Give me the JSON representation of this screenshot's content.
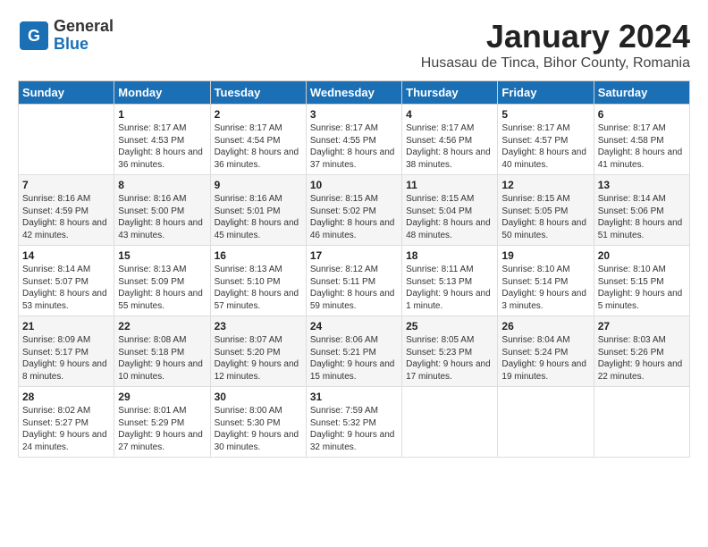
{
  "header": {
    "logo_general": "General",
    "logo_blue": "Blue",
    "month_title": "January 2024",
    "location": "Husasau de Tinca, Bihor County, Romania"
  },
  "weekdays": [
    "Sunday",
    "Monday",
    "Tuesday",
    "Wednesday",
    "Thursday",
    "Friday",
    "Saturday"
  ],
  "weeks": [
    [
      {
        "day": "",
        "sunrise": "",
        "sunset": "",
        "daylight": ""
      },
      {
        "day": "1",
        "sunrise": "Sunrise: 8:17 AM",
        "sunset": "Sunset: 4:53 PM",
        "daylight": "Daylight: 8 hours and 36 minutes."
      },
      {
        "day": "2",
        "sunrise": "Sunrise: 8:17 AM",
        "sunset": "Sunset: 4:54 PM",
        "daylight": "Daylight: 8 hours and 36 minutes."
      },
      {
        "day": "3",
        "sunrise": "Sunrise: 8:17 AM",
        "sunset": "Sunset: 4:55 PM",
        "daylight": "Daylight: 8 hours and 37 minutes."
      },
      {
        "day": "4",
        "sunrise": "Sunrise: 8:17 AM",
        "sunset": "Sunset: 4:56 PM",
        "daylight": "Daylight: 8 hours and 38 minutes."
      },
      {
        "day": "5",
        "sunrise": "Sunrise: 8:17 AM",
        "sunset": "Sunset: 4:57 PM",
        "daylight": "Daylight: 8 hours and 40 minutes."
      },
      {
        "day": "6",
        "sunrise": "Sunrise: 8:17 AM",
        "sunset": "Sunset: 4:58 PM",
        "daylight": "Daylight: 8 hours and 41 minutes."
      }
    ],
    [
      {
        "day": "7",
        "sunrise": "Sunrise: 8:16 AM",
        "sunset": "Sunset: 4:59 PM",
        "daylight": "Daylight: 8 hours and 42 minutes."
      },
      {
        "day": "8",
        "sunrise": "Sunrise: 8:16 AM",
        "sunset": "Sunset: 5:00 PM",
        "daylight": "Daylight: 8 hours and 43 minutes."
      },
      {
        "day": "9",
        "sunrise": "Sunrise: 8:16 AM",
        "sunset": "Sunset: 5:01 PM",
        "daylight": "Daylight: 8 hours and 45 minutes."
      },
      {
        "day": "10",
        "sunrise": "Sunrise: 8:15 AM",
        "sunset": "Sunset: 5:02 PM",
        "daylight": "Daylight: 8 hours and 46 minutes."
      },
      {
        "day": "11",
        "sunrise": "Sunrise: 8:15 AM",
        "sunset": "Sunset: 5:04 PM",
        "daylight": "Daylight: 8 hours and 48 minutes."
      },
      {
        "day": "12",
        "sunrise": "Sunrise: 8:15 AM",
        "sunset": "Sunset: 5:05 PM",
        "daylight": "Daylight: 8 hours and 50 minutes."
      },
      {
        "day": "13",
        "sunrise": "Sunrise: 8:14 AM",
        "sunset": "Sunset: 5:06 PM",
        "daylight": "Daylight: 8 hours and 51 minutes."
      }
    ],
    [
      {
        "day": "14",
        "sunrise": "Sunrise: 8:14 AM",
        "sunset": "Sunset: 5:07 PM",
        "daylight": "Daylight: 8 hours and 53 minutes."
      },
      {
        "day": "15",
        "sunrise": "Sunrise: 8:13 AM",
        "sunset": "Sunset: 5:09 PM",
        "daylight": "Daylight: 8 hours and 55 minutes."
      },
      {
        "day": "16",
        "sunrise": "Sunrise: 8:13 AM",
        "sunset": "Sunset: 5:10 PM",
        "daylight": "Daylight: 8 hours and 57 minutes."
      },
      {
        "day": "17",
        "sunrise": "Sunrise: 8:12 AM",
        "sunset": "Sunset: 5:11 PM",
        "daylight": "Daylight: 8 hours and 59 minutes."
      },
      {
        "day": "18",
        "sunrise": "Sunrise: 8:11 AM",
        "sunset": "Sunset: 5:13 PM",
        "daylight": "Daylight: 9 hours and 1 minute."
      },
      {
        "day": "19",
        "sunrise": "Sunrise: 8:10 AM",
        "sunset": "Sunset: 5:14 PM",
        "daylight": "Daylight: 9 hours and 3 minutes."
      },
      {
        "day": "20",
        "sunrise": "Sunrise: 8:10 AM",
        "sunset": "Sunset: 5:15 PM",
        "daylight": "Daylight: 9 hours and 5 minutes."
      }
    ],
    [
      {
        "day": "21",
        "sunrise": "Sunrise: 8:09 AM",
        "sunset": "Sunset: 5:17 PM",
        "daylight": "Daylight: 9 hours and 8 minutes."
      },
      {
        "day": "22",
        "sunrise": "Sunrise: 8:08 AM",
        "sunset": "Sunset: 5:18 PM",
        "daylight": "Daylight: 9 hours and 10 minutes."
      },
      {
        "day": "23",
        "sunrise": "Sunrise: 8:07 AM",
        "sunset": "Sunset: 5:20 PM",
        "daylight": "Daylight: 9 hours and 12 minutes."
      },
      {
        "day": "24",
        "sunrise": "Sunrise: 8:06 AM",
        "sunset": "Sunset: 5:21 PM",
        "daylight": "Daylight: 9 hours and 15 minutes."
      },
      {
        "day": "25",
        "sunrise": "Sunrise: 8:05 AM",
        "sunset": "Sunset: 5:23 PM",
        "daylight": "Daylight: 9 hours and 17 minutes."
      },
      {
        "day": "26",
        "sunrise": "Sunrise: 8:04 AM",
        "sunset": "Sunset: 5:24 PM",
        "daylight": "Daylight: 9 hours and 19 minutes."
      },
      {
        "day": "27",
        "sunrise": "Sunrise: 8:03 AM",
        "sunset": "Sunset: 5:26 PM",
        "daylight": "Daylight: 9 hours and 22 minutes."
      }
    ],
    [
      {
        "day": "28",
        "sunrise": "Sunrise: 8:02 AM",
        "sunset": "Sunset: 5:27 PM",
        "daylight": "Daylight: 9 hours and 24 minutes."
      },
      {
        "day": "29",
        "sunrise": "Sunrise: 8:01 AM",
        "sunset": "Sunset: 5:29 PM",
        "daylight": "Daylight: 9 hours and 27 minutes."
      },
      {
        "day": "30",
        "sunrise": "Sunrise: 8:00 AM",
        "sunset": "Sunset: 5:30 PM",
        "daylight": "Daylight: 9 hours and 30 minutes."
      },
      {
        "day": "31",
        "sunrise": "Sunrise: 7:59 AM",
        "sunset": "Sunset: 5:32 PM",
        "daylight": "Daylight: 9 hours and 32 minutes."
      },
      {
        "day": "",
        "sunrise": "",
        "sunset": "",
        "daylight": ""
      },
      {
        "day": "",
        "sunrise": "",
        "sunset": "",
        "daylight": ""
      },
      {
        "day": "",
        "sunrise": "",
        "sunset": "",
        "daylight": ""
      }
    ]
  ]
}
